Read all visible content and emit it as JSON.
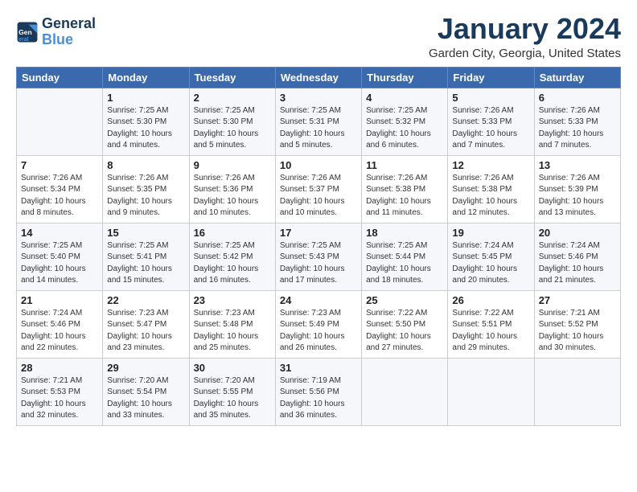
{
  "header": {
    "logo_line1": "General",
    "logo_line2": "Blue",
    "title": "January 2024",
    "location": "Garden City, Georgia, United States"
  },
  "weekdays": [
    "Sunday",
    "Monday",
    "Tuesday",
    "Wednesday",
    "Thursday",
    "Friday",
    "Saturday"
  ],
  "weeks": [
    [
      {
        "num": "",
        "sunrise": "",
        "sunset": "",
        "daylight": ""
      },
      {
        "num": "1",
        "sunrise": "Sunrise: 7:25 AM",
        "sunset": "Sunset: 5:30 PM",
        "daylight": "Daylight: 10 hours and 4 minutes."
      },
      {
        "num": "2",
        "sunrise": "Sunrise: 7:25 AM",
        "sunset": "Sunset: 5:30 PM",
        "daylight": "Daylight: 10 hours and 5 minutes."
      },
      {
        "num": "3",
        "sunrise": "Sunrise: 7:25 AM",
        "sunset": "Sunset: 5:31 PM",
        "daylight": "Daylight: 10 hours and 5 minutes."
      },
      {
        "num": "4",
        "sunrise": "Sunrise: 7:25 AM",
        "sunset": "Sunset: 5:32 PM",
        "daylight": "Daylight: 10 hours and 6 minutes."
      },
      {
        "num": "5",
        "sunrise": "Sunrise: 7:26 AM",
        "sunset": "Sunset: 5:33 PM",
        "daylight": "Daylight: 10 hours and 7 minutes."
      },
      {
        "num": "6",
        "sunrise": "Sunrise: 7:26 AM",
        "sunset": "Sunset: 5:33 PM",
        "daylight": "Daylight: 10 hours and 7 minutes."
      }
    ],
    [
      {
        "num": "7",
        "sunrise": "Sunrise: 7:26 AM",
        "sunset": "Sunset: 5:34 PM",
        "daylight": "Daylight: 10 hours and 8 minutes."
      },
      {
        "num": "8",
        "sunrise": "Sunrise: 7:26 AM",
        "sunset": "Sunset: 5:35 PM",
        "daylight": "Daylight: 10 hours and 9 minutes."
      },
      {
        "num": "9",
        "sunrise": "Sunrise: 7:26 AM",
        "sunset": "Sunset: 5:36 PM",
        "daylight": "Daylight: 10 hours and 10 minutes."
      },
      {
        "num": "10",
        "sunrise": "Sunrise: 7:26 AM",
        "sunset": "Sunset: 5:37 PM",
        "daylight": "Daylight: 10 hours and 10 minutes."
      },
      {
        "num": "11",
        "sunrise": "Sunrise: 7:26 AM",
        "sunset": "Sunset: 5:38 PM",
        "daylight": "Daylight: 10 hours and 11 minutes."
      },
      {
        "num": "12",
        "sunrise": "Sunrise: 7:26 AM",
        "sunset": "Sunset: 5:38 PM",
        "daylight": "Daylight: 10 hours and 12 minutes."
      },
      {
        "num": "13",
        "sunrise": "Sunrise: 7:26 AM",
        "sunset": "Sunset: 5:39 PM",
        "daylight": "Daylight: 10 hours and 13 minutes."
      }
    ],
    [
      {
        "num": "14",
        "sunrise": "Sunrise: 7:25 AM",
        "sunset": "Sunset: 5:40 PM",
        "daylight": "Daylight: 10 hours and 14 minutes."
      },
      {
        "num": "15",
        "sunrise": "Sunrise: 7:25 AM",
        "sunset": "Sunset: 5:41 PM",
        "daylight": "Daylight: 10 hours and 15 minutes."
      },
      {
        "num": "16",
        "sunrise": "Sunrise: 7:25 AM",
        "sunset": "Sunset: 5:42 PM",
        "daylight": "Daylight: 10 hours and 16 minutes."
      },
      {
        "num": "17",
        "sunrise": "Sunrise: 7:25 AM",
        "sunset": "Sunset: 5:43 PM",
        "daylight": "Daylight: 10 hours and 17 minutes."
      },
      {
        "num": "18",
        "sunrise": "Sunrise: 7:25 AM",
        "sunset": "Sunset: 5:44 PM",
        "daylight": "Daylight: 10 hours and 18 minutes."
      },
      {
        "num": "19",
        "sunrise": "Sunrise: 7:24 AM",
        "sunset": "Sunset: 5:45 PM",
        "daylight": "Daylight: 10 hours and 20 minutes."
      },
      {
        "num": "20",
        "sunrise": "Sunrise: 7:24 AM",
        "sunset": "Sunset: 5:46 PM",
        "daylight": "Daylight: 10 hours and 21 minutes."
      }
    ],
    [
      {
        "num": "21",
        "sunrise": "Sunrise: 7:24 AM",
        "sunset": "Sunset: 5:46 PM",
        "daylight": "Daylight: 10 hours and 22 minutes."
      },
      {
        "num": "22",
        "sunrise": "Sunrise: 7:23 AM",
        "sunset": "Sunset: 5:47 PM",
        "daylight": "Daylight: 10 hours and 23 minutes."
      },
      {
        "num": "23",
        "sunrise": "Sunrise: 7:23 AM",
        "sunset": "Sunset: 5:48 PM",
        "daylight": "Daylight: 10 hours and 25 minutes."
      },
      {
        "num": "24",
        "sunrise": "Sunrise: 7:23 AM",
        "sunset": "Sunset: 5:49 PM",
        "daylight": "Daylight: 10 hours and 26 minutes."
      },
      {
        "num": "25",
        "sunrise": "Sunrise: 7:22 AM",
        "sunset": "Sunset: 5:50 PM",
        "daylight": "Daylight: 10 hours and 27 minutes."
      },
      {
        "num": "26",
        "sunrise": "Sunrise: 7:22 AM",
        "sunset": "Sunset: 5:51 PM",
        "daylight": "Daylight: 10 hours and 29 minutes."
      },
      {
        "num": "27",
        "sunrise": "Sunrise: 7:21 AM",
        "sunset": "Sunset: 5:52 PM",
        "daylight": "Daylight: 10 hours and 30 minutes."
      }
    ],
    [
      {
        "num": "28",
        "sunrise": "Sunrise: 7:21 AM",
        "sunset": "Sunset: 5:53 PM",
        "daylight": "Daylight: 10 hours and 32 minutes."
      },
      {
        "num": "29",
        "sunrise": "Sunrise: 7:20 AM",
        "sunset": "Sunset: 5:54 PM",
        "daylight": "Daylight: 10 hours and 33 minutes."
      },
      {
        "num": "30",
        "sunrise": "Sunrise: 7:20 AM",
        "sunset": "Sunset: 5:55 PM",
        "daylight": "Daylight: 10 hours and 35 minutes."
      },
      {
        "num": "31",
        "sunrise": "Sunrise: 7:19 AM",
        "sunset": "Sunset: 5:56 PM",
        "daylight": "Daylight: 10 hours and 36 minutes."
      },
      {
        "num": "",
        "sunrise": "",
        "sunset": "",
        "daylight": ""
      },
      {
        "num": "",
        "sunrise": "",
        "sunset": "",
        "daylight": ""
      },
      {
        "num": "",
        "sunrise": "",
        "sunset": "",
        "daylight": ""
      }
    ]
  ]
}
